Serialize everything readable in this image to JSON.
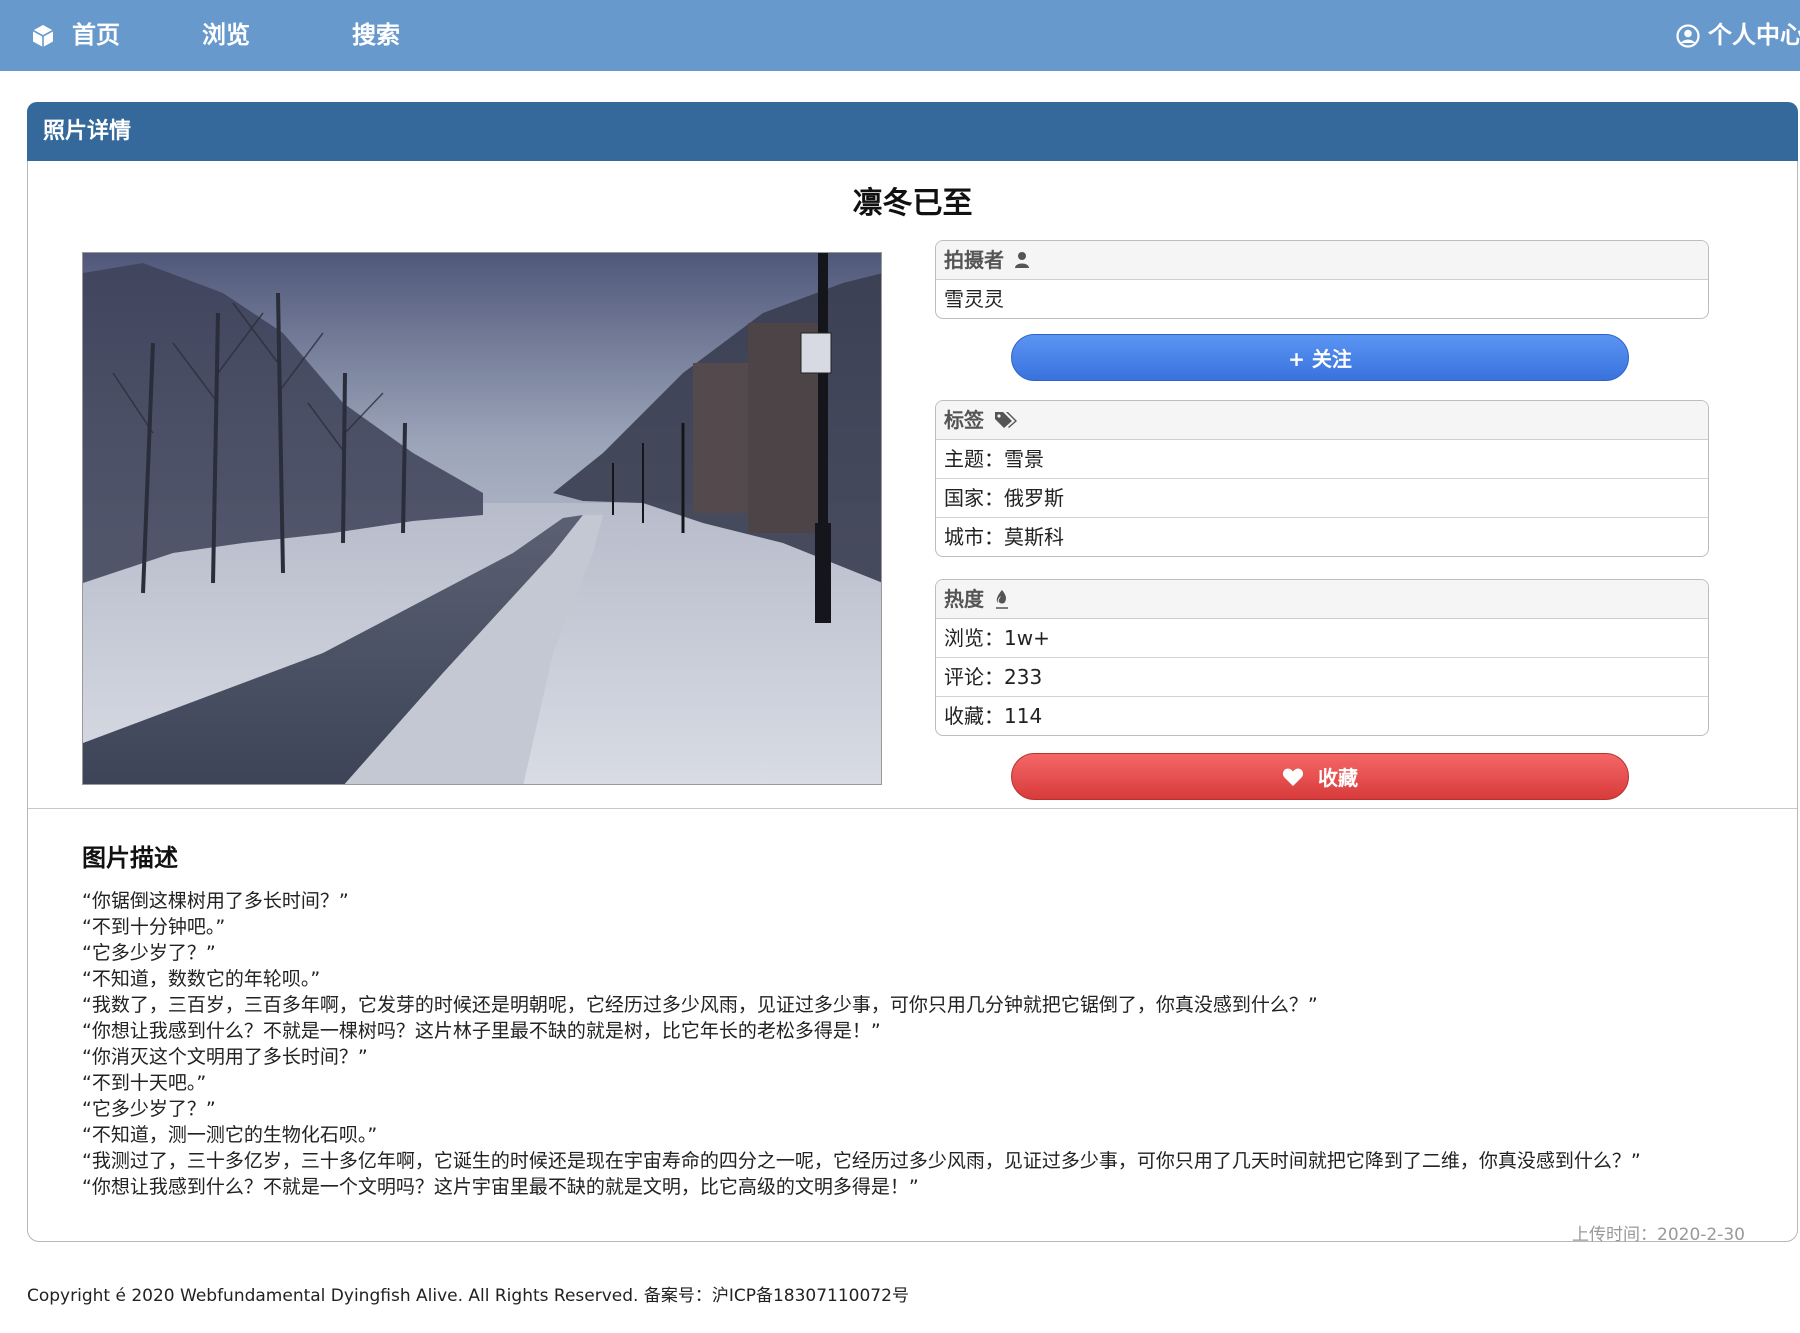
{
  "nav": {
    "home_label": "首页",
    "browse_label": "浏览",
    "search_label": "搜索",
    "user_label": "个人中心",
    "home_icon": "cube-icon",
    "user_icon": "user-circle-icon",
    "bg_color": "#6799cc"
  },
  "card": {
    "header_title": "照片详情",
    "header_color": "#35699c"
  },
  "photo": {
    "title": "凛冬已至"
  },
  "photographer": {
    "heading": "拍摄者",
    "icon": "user-icon",
    "name": "雪灵灵"
  },
  "follow_button": {
    "label": "+ 关注",
    "color": "#4a84ea"
  },
  "tags": {
    "heading": "标签",
    "icon": "tags-icon",
    "items": [
      {
        "key": "主题：",
        "value": "雪景"
      },
      {
        "key": "国家：",
        "value": "俄罗斯"
      },
      {
        "key": "城市：",
        "value": "莫斯科"
      }
    ]
  },
  "heat": {
    "heading": "热度",
    "icon": "fire-icon",
    "items": [
      {
        "key": "浏览：",
        "value": "1w+"
      },
      {
        "key": "评论：",
        "value": "233"
      },
      {
        "key": "收藏：",
        "value": "114"
      }
    ]
  },
  "favorite_button": {
    "label": "收藏",
    "icon": "heart-icon",
    "color": "#e74c4c"
  },
  "description": {
    "title": "图片描述",
    "lines": [
      "“你锯倒这棵树用了多长时间？”",
      "“不到十分钟吧。”",
      "“它多少岁了？”",
      "“不知道，数数它的年轮呗。”",
      "“我数了，三百岁，三百多年啊，它发芽的时候还是明朝呢，它经历过多少风雨，见证过多少事，可你只用几分钟就把它锯倒了，你真没感到什么？”",
      "“你想让我感到什么？不就是一棵树吗？这片林子里最不缺的就是树，比它年长的老松多得是！”",
      "“你消灭这个文明用了多长时间？”",
      "“不到十天吧。”",
      "“它多少岁了？”",
      "“不知道，测一测它的生物化石呗。”",
      "“我测过了，三十多亿岁，三十多亿年啊，它诞生的时候还是现在宇宙寿命的四分之一呢，它经历过多少风雨，见证过多少事，可你只用了几天时间就把它降到了二维，你真没感到什么？”",
      "“你想让我感到什么？不就是一个文明吗？这片宇宙里最不缺的就是文明，比它高级的文明多得是！”"
    ]
  },
  "upload": {
    "label": "上传时间：",
    "date": "2020-2-30"
  },
  "footer": {
    "text": "Copyright é 2020 Webfundamental Dyingfish Alive. All Rights Reserved. 备案号：沪ICP备18307110072号"
  }
}
